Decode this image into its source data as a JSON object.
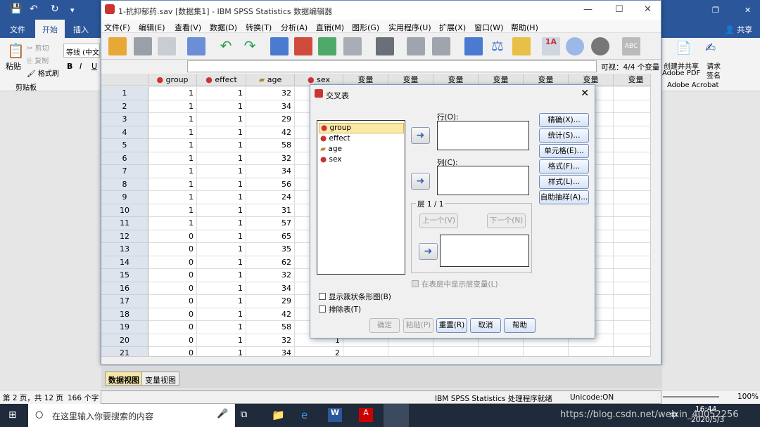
{
  "word": {
    "tabs": [
      "文件",
      "开始",
      "插入"
    ],
    "share": "共享",
    "clipboard": {
      "paste": "粘贴",
      "cut": "剪切",
      "copy": "复制",
      "format_painter": "格式刷",
      "group": "剪贴板"
    },
    "font_name": "等线 (中文",
    "acrobat": {
      "create_share": "创建并共享",
      "adobe_pdf": "Adobe PDF",
      "request_sign": "请求",
      "sign": "签名",
      "group": "Adobe Acrobat"
    },
    "status_page": "第 2 页，共 12 页",
    "status_chars": "166 个字",
    "zoom": "100%"
  },
  "taskbar": {
    "search_placeholder": "在这里输入你要搜索的内容",
    "time": "16:44",
    "date": "2020/5/3",
    "watermark": "https://blog.csdn.net/weixin_40052256",
    "ime": "中"
  },
  "spss": {
    "title": "1-抗抑郁药.sav [数据集1] - IBM SPSS Statistics 数据编辑器",
    "menu": [
      "文件(F)",
      "编辑(E)",
      "查看(V)",
      "数据(D)",
      "转换(T)",
      "分析(A)",
      "直销(M)",
      "图形(G)",
      "实用程序(U)",
      "扩展(X)",
      "窗口(W)",
      "帮助(H)"
    ],
    "visible": "可视：4/4 个变量",
    "columns": [
      "group",
      "effect",
      "age",
      "sex",
      "变量",
      "变量",
      "变量",
      "变量",
      "变量",
      "变量",
      "变量"
    ],
    "rows": [
      [
        1,
        1,
        32
      ],
      [
        1,
        1,
        34
      ],
      [
        1,
        1,
        29
      ],
      [
        1,
        1,
        42
      ],
      [
        1,
        1,
        58
      ],
      [
        1,
        1,
        32
      ],
      [
        1,
        1,
        34
      ],
      [
        1,
        1,
        56
      ],
      [
        1,
        1,
        24
      ],
      [
        1,
        1,
        31
      ],
      [
        1,
        1,
        57
      ],
      [
        0,
        1,
        65
      ],
      [
        0,
        1,
        35
      ],
      [
        0,
        1,
        62
      ],
      [
        0,
        1,
        32
      ],
      [
        0,
        1,
        34
      ],
      [
        0,
        1,
        29
      ],
      [
        0,
        1,
        42
      ],
      [
        0,
        1,
        58
      ],
      [
        0,
        1,
        32
      ],
      [
        0,
        1,
        34
      ]
    ],
    "sex_partial": [
      "",
      "",
      "",
      "",
      "",
      "",
      "",
      "",
      "",
      "",
      "",
      "",
      "",
      "",
      "",
      "",
      "",
      "",
      "",
      "1",
      "2"
    ],
    "tab_data": "数据视图",
    "tab_var": "变量视图",
    "status_processor": "IBM SPSS Statistics 处理程序就绪",
    "status_unicode": "Unicode:ON"
  },
  "dialog": {
    "title": "交叉表",
    "vars": [
      "group",
      "effect",
      "age",
      "sex"
    ],
    "row_label": "行(O):",
    "col_label": "列(C):",
    "layer_label": "层 1 / 1",
    "prev": "上一个(V)",
    "next": "下一个(N)",
    "layer_display": "在表层中显示层变量(L)",
    "clustered_bar": "显示簇状条形图(B)",
    "suppress": "排除表(T)",
    "side_buttons": [
      "精确(X)...",
      "统计(S)...",
      "单元格(E)...",
      "格式(F)...",
      "样式(L)...",
      "自助抽样(A)..."
    ],
    "ok": "确定",
    "paste": "粘贴(P)",
    "reset": "重置(R)",
    "cancel": "取消",
    "help": "帮助"
  }
}
